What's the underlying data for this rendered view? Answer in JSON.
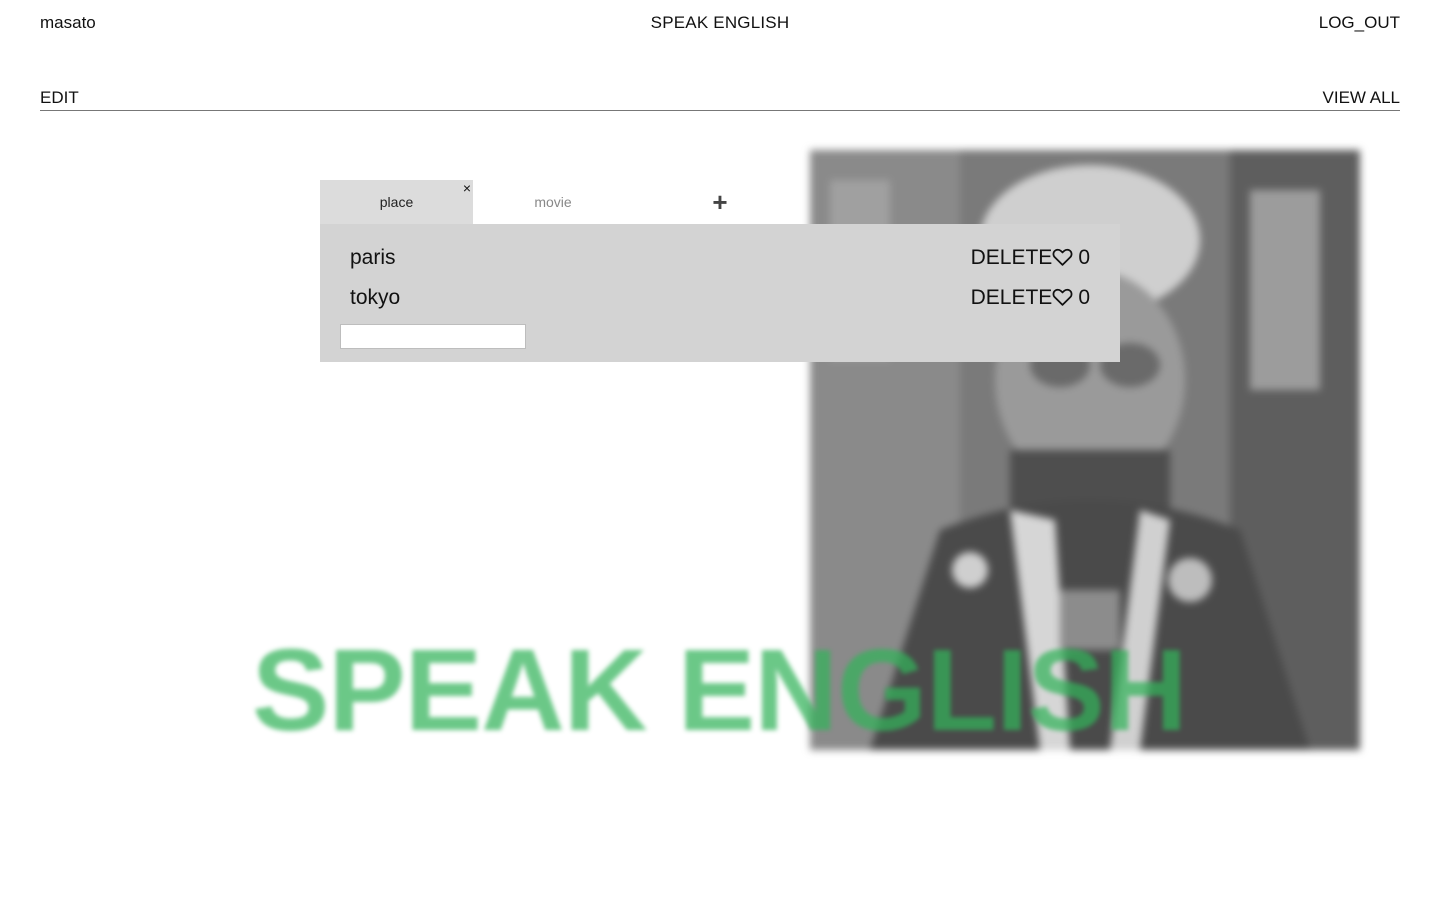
{
  "header": {
    "username": "masato",
    "title": "SPEAK ENGLISH",
    "logout_label": "LOG_OUT"
  },
  "subnav": {
    "edit_label": "EDIT",
    "view_all_label": "VIEW ALL"
  },
  "tabs": [
    {
      "label": "place",
      "active": true,
      "close_glyph": "×"
    },
    {
      "label": "movie",
      "active": false
    }
  ],
  "add_tab_glyph": "+",
  "items": [
    {
      "name": "paris",
      "delete_label": "DELETE",
      "like_icon": "heart-outline-icon",
      "likes": "0"
    },
    {
      "name": "tokyo",
      "delete_label": "DELETE",
      "like_icon": "heart-outline-icon",
      "likes": "0"
    }
  ],
  "new_item_input": {
    "value": "",
    "placeholder": ""
  },
  "wordmark": "SPEAK ENGLISH",
  "colors": {
    "wordmark": "#33b35a",
    "panel": "#d3d3d3",
    "active_tab": "#dcdcdc"
  }
}
